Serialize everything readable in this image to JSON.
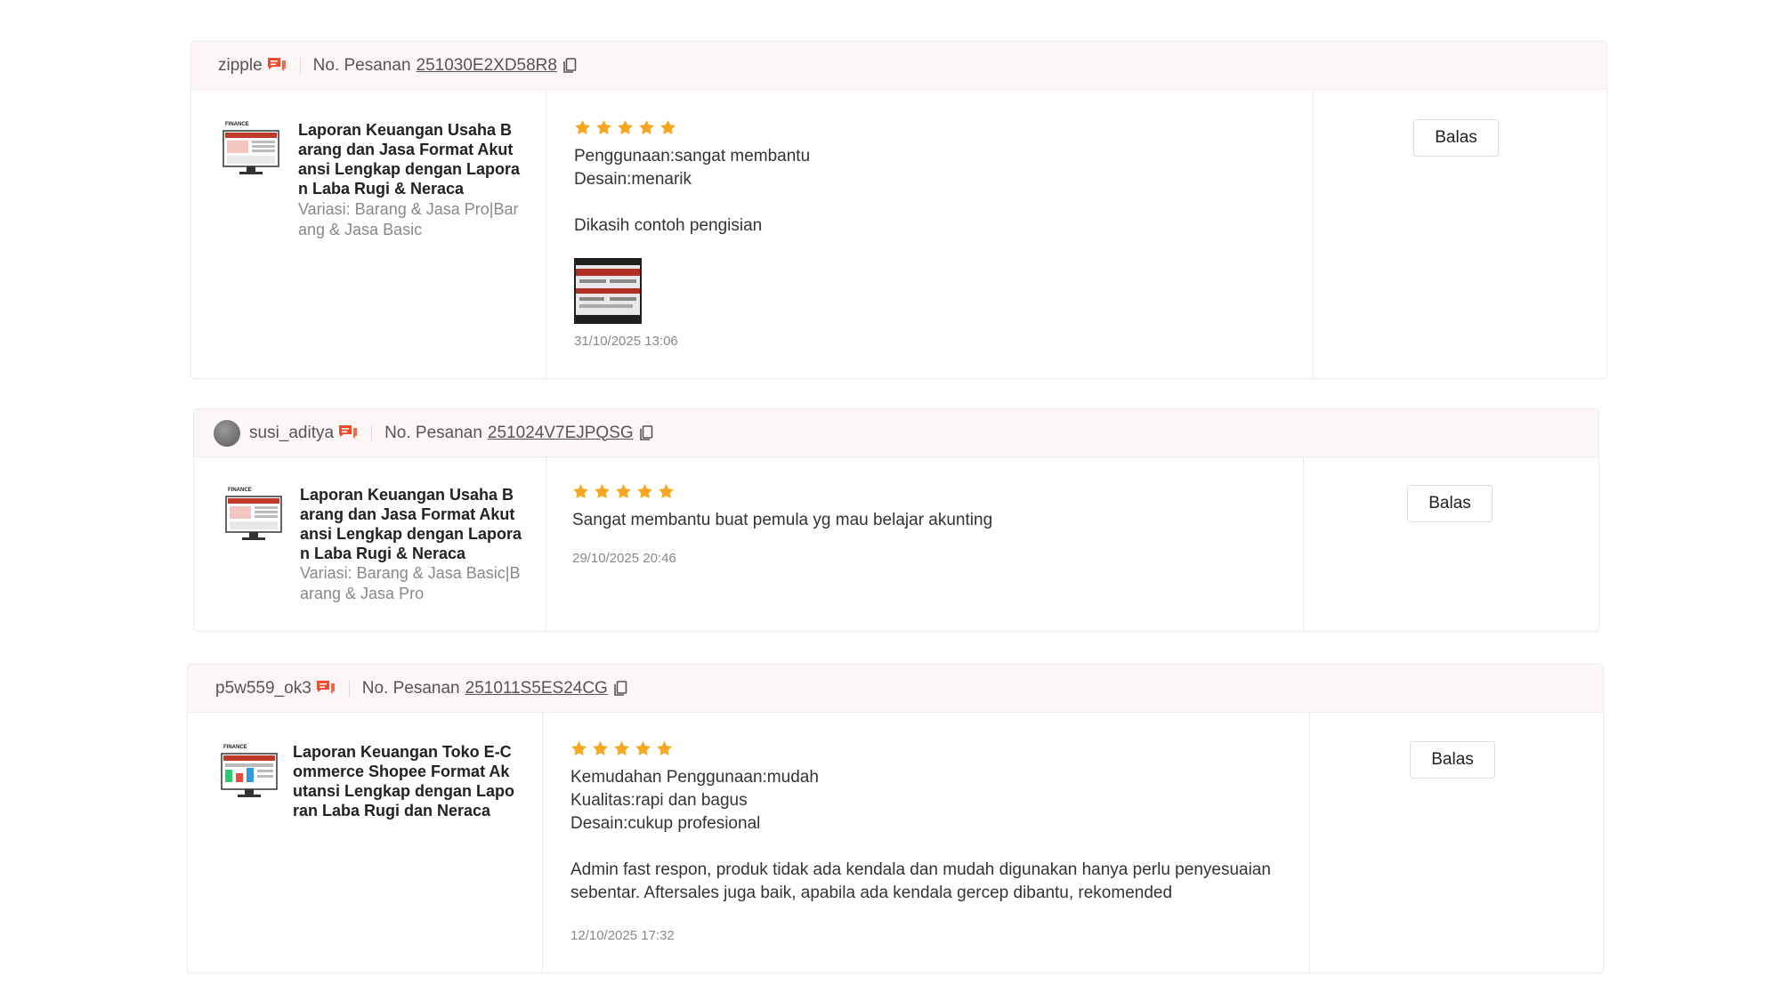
{
  "common": {
    "order_label": "No. Pesanan",
    "reply_label": "Balas"
  },
  "reviews": [
    {
      "username": "zipple",
      "order_id": "251030E2XD58R8",
      "product_title": "Laporan Keuangan Usaha Barang dan Jasa Format Akutansi Lengkap dengan Laporan Laba Rugi & Neraca",
      "variation": "Variasi: Barang & Jasa Pro|Barang & Jasa Basic",
      "rating": 5,
      "review_text": "Penggunaan:sangat membantu\nDesain:menarik\n\nDikasih contoh pengisian",
      "date": "31/10/2025 13:06",
      "has_photo": true
    },
    {
      "username": "susi_aditya",
      "order_id": "251024V7EJPQSG",
      "product_title": "Laporan Keuangan Usaha Barang dan Jasa Format Akutansi Lengkap dengan Laporan Laba Rugi & Neraca",
      "variation": "Variasi: Barang & Jasa Basic|Barang & Jasa Pro",
      "rating": 5,
      "review_text": "Sangat membantu buat pemula yg mau belajar akunting",
      "date": "29/10/2025 20:46",
      "has_photo": false
    },
    {
      "username": "p5w559_ok3",
      "order_id": "251011S5ES24CG",
      "product_title": "Laporan Keuangan Toko E-Commerce Shopee Format Akutansi Lengkap dengan Laporan Laba Rugi dan Neraca",
      "variation": "",
      "rating": 5,
      "review_text": "Kemudahan Penggunaan:mudah\nKualitas:rapi dan bagus\nDesain:cukup profesional\n\nAdmin fast respon, produk tidak ada kendala dan mudah digunakan hanya perlu penyesuaian sebentar. Aftersales juga baik, apabila ada kendala gercep dibantu, rekomended",
      "date": "12/10/2025 17:32",
      "has_photo": false
    }
  ],
  "colors": {
    "star": "#f5a623",
    "chat_icon": "#ee4d2d",
    "header_bg": "#fdf6f6"
  }
}
